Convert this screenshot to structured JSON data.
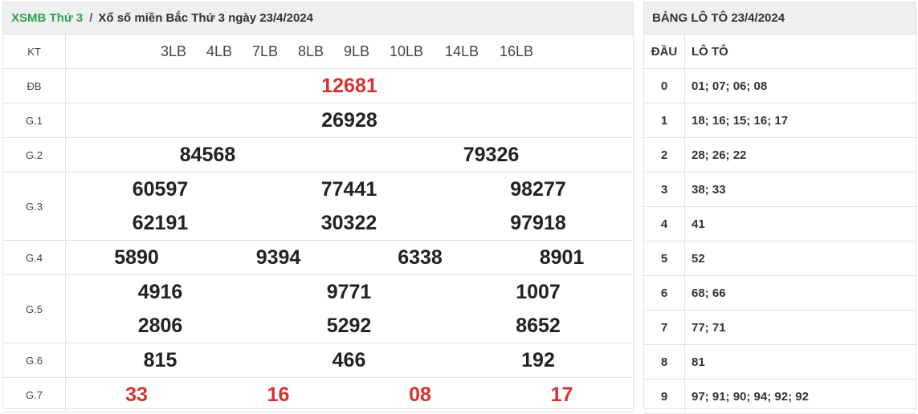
{
  "left": {
    "breadcrumb_link": "XSMB Thứ 3",
    "breadcrumb_sep": "/",
    "breadcrumb_title": "Xổ số miền Bắc Thứ 3 ngày 23/4/2024",
    "kt_label": "KT",
    "kt_codes": [
      "3LB",
      "4LB",
      "7LB",
      "8LB",
      "9LB",
      "10LB",
      "14LB",
      "16LB"
    ],
    "prizes": {
      "db": {
        "label": "ĐB",
        "numbers": [
          "12681"
        ]
      },
      "g1": {
        "label": "G.1",
        "numbers": [
          "26928"
        ]
      },
      "g2": {
        "label": "G.2",
        "numbers": [
          "84568",
          "79326"
        ]
      },
      "g3": {
        "label": "G.3",
        "numbers": [
          "60597",
          "77441",
          "98277",
          "62191",
          "30322",
          "97918"
        ]
      },
      "g4": {
        "label": "G.4",
        "numbers": [
          "5890",
          "9394",
          "6338",
          "8901"
        ]
      },
      "g5": {
        "label": "G.5",
        "numbers": [
          "4916",
          "9771",
          "1007",
          "2806",
          "5292",
          "8652"
        ]
      },
      "g6": {
        "label": "G.6",
        "numbers": [
          "815",
          "466",
          "192"
        ]
      },
      "g7": {
        "label": "G.7",
        "numbers": [
          "33",
          "16",
          "08",
          "17"
        ]
      }
    }
  },
  "right": {
    "title": "BẢNG LÔ TÔ 23/4/2024",
    "col_dau": "ĐẦU",
    "col_loto": "LÔ TÔ",
    "rows": [
      {
        "dau": "0",
        "loto": "01; 07; 06; 08"
      },
      {
        "dau": "1",
        "loto": "18; 16; 15; 16; 17"
      },
      {
        "dau": "2",
        "loto": "28; 26; 22"
      },
      {
        "dau": "3",
        "loto": "38; 33"
      },
      {
        "dau": "4",
        "loto": "41"
      },
      {
        "dau": "5",
        "loto": "52"
      },
      {
        "dau": "6",
        "loto": "68; 66"
      },
      {
        "dau": "7",
        "loto": "77; 71"
      },
      {
        "dau": "8",
        "loto": "81"
      },
      {
        "dau": "9",
        "loto": "97; 91; 90; 94; 92; 92"
      }
    ]
  },
  "colors": {
    "accent_green": "#31a24c",
    "highlight_red": "#d6322f",
    "header_bg": "#efefef"
  }
}
